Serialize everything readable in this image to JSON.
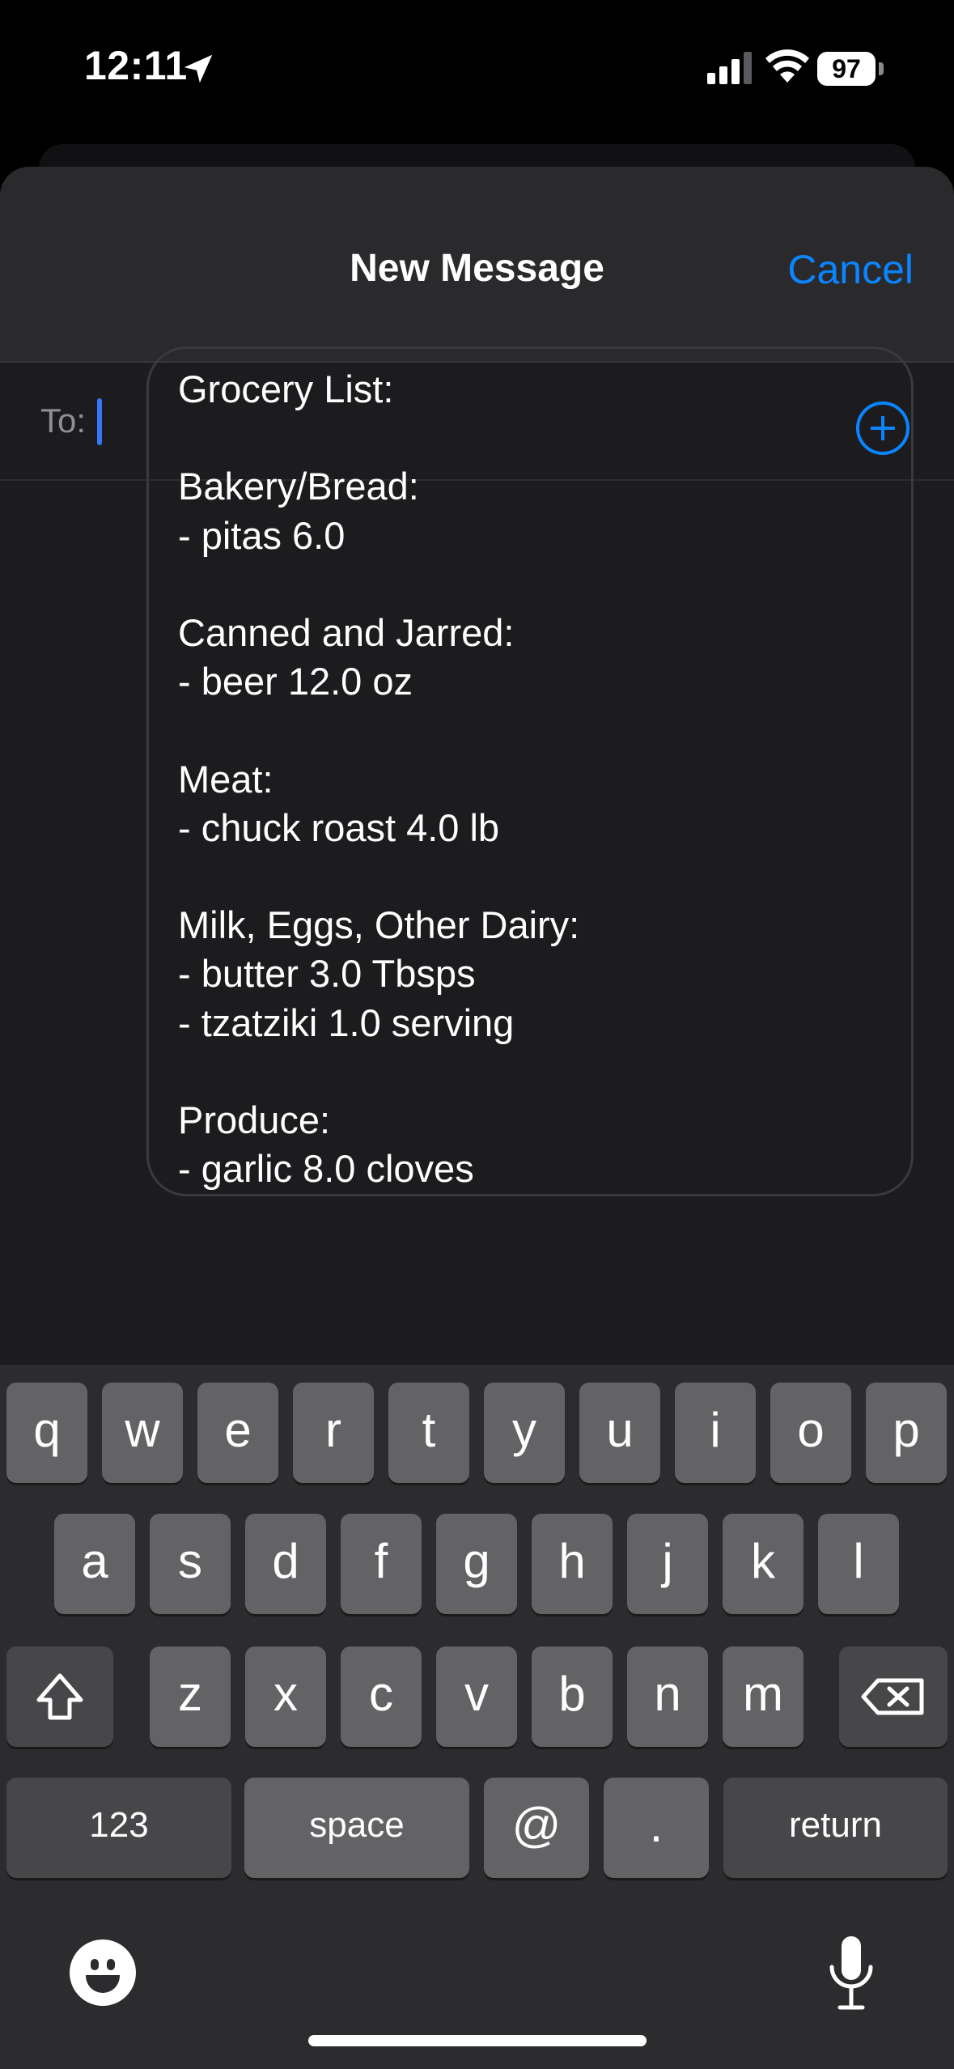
{
  "status_bar": {
    "time": "12:11",
    "battery": "97"
  },
  "nav": {
    "title": "New Message",
    "cancel_label": "Cancel"
  },
  "to_field": {
    "label": "To:"
  },
  "message": {
    "lines": [
      "Grocery List:",
      "",
      "Bakery/Bread:",
      "- pitas 6.0",
      "",
      "Canned and Jarred:",
      "- beer 12.0 oz",
      "",
      "Meat:",
      "- chuck roast 4.0 lb",
      "",
      "Milk, Eggs, Other Dairy:",
      "- butter 3.0 Tbsps",
      "- tzatziki 1.0 serving",
      "",
      "Produce:",
      "- garlic 8.0 cloves"
    ]
  },
  "keyboard": {
    "row1": [
      "q",
      "w",
      "e",
      "r",
      "t",
      "y",
      "u",
      "i",
      "o",
      "p"
    ],
    "row2": [
      "a",
      "s",
      "d",
      "f",
      "g",
      "h",
      "j",
      "k",
      "l"
    ],
    "row3": [
      "z",
      "x",
      "c",
      "v",
      "b",
      "n",
      "m"
    ],
    "numbers_label": "123",
    "space_label": "space",
    "at_label": "@",
    "period_label": ".",
    "return_label": "return"
  },
  "icons": {
    "location": "location-arrow-icon",
    "signal": "cellular-signal-icon",
    "wifi": "wifi-icon",
    "battery": "battery-icon",
    "add_recipient": "plus-circle-icon",
    "attach": "plus-icon",
    "send": "arrow-up-icon",
    "shift": "shift-arrow-icon",
    "delete": "backspace-icon",
    "emoji": "emoji-smiley-icon",
    "mic": "microphone-icon"
  },
  "colors": {
    "accent": "#0a84ff",
    "caret": "#3478f6"
  }
}
